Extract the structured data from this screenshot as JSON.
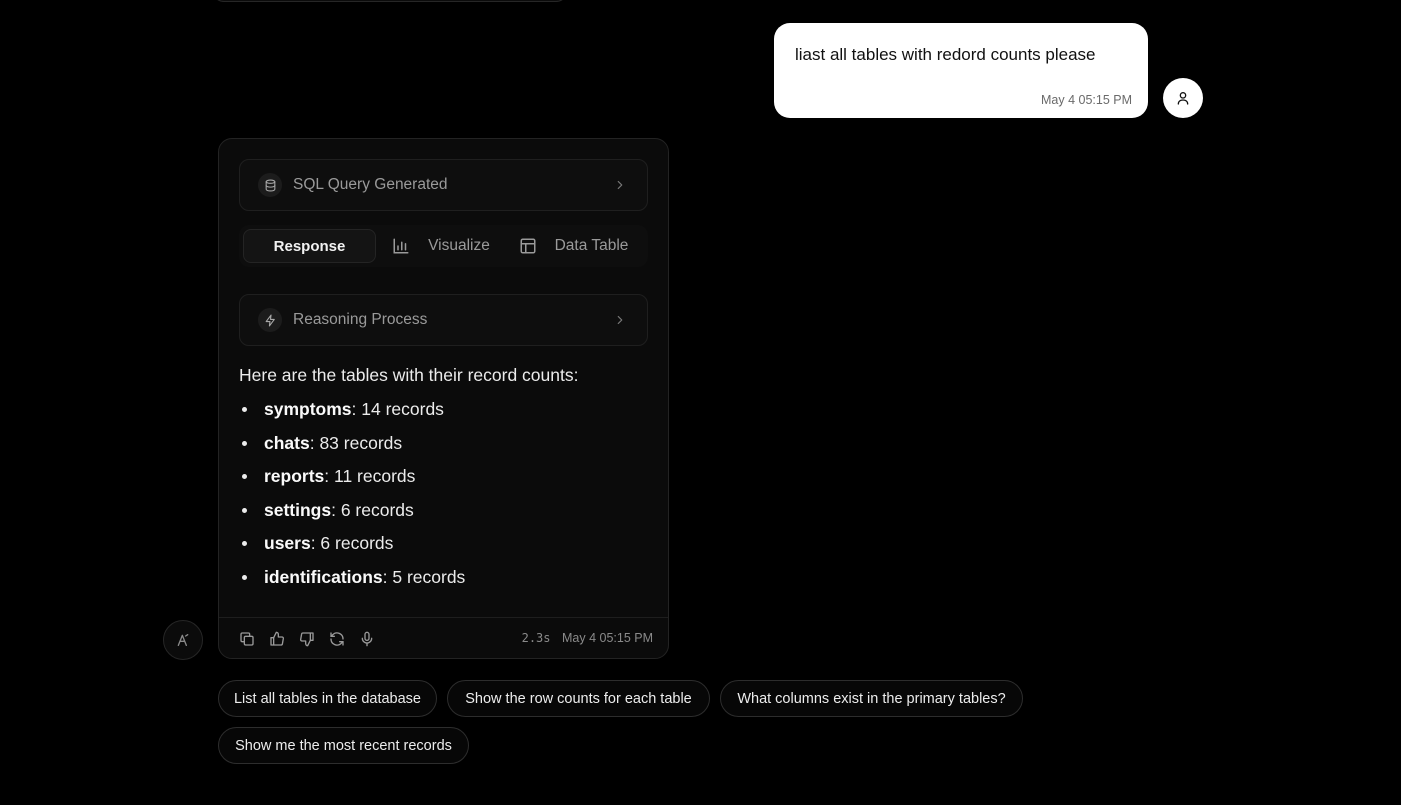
{
  "user_message": {
    "text": "liast all tables with redord counts please",
    "time": "May 4 05:15 PM"
  },
  "assistant": {
    "sql_label": "SQL Query Generated",
    "tabs": [
      {
        "label": "Response",
        "icon": "none",
        "active": true
      },
      {
        "label": "Visualize",
        "icon": "bar-chart-icon",
        "active": false
      },
      {
        "label": "Data Table",
        "icon": "table-icon",
        "active": false
      }
    ],
    "reasoning_label": "Reasoning Process",
    "intro": "Here are the tables with their record counts:",
    "items": [
      {
        "name": "symptoms",
        "rest": ": 14 records"
      },
      {
        "name": "chats",
        "rest": ": 83 records"
      },
      {
        "name": "reports",
        "rest": ": 11 records"
      },
      {
        "name": "settings",
        "rest": ": 6 records"
      },
      {
        "name": "users",
        "rest": ": 6 records"
      },
      {
        "name": "identifications",
        "rest": ": 5 records"
      }
    ],
    "footer": {
      "icons": [
        "copy-icon",
        "thumbs-up-icon",
        "thumbs-down-icon",
        "regenerate-icon",
        "microphone-icon"
      ],
      "duration": "2.3s",
      "time": "May 4 05:15 PM"
    }
  },
  "suggestions": [
    "List all tables in the database",
    "Show the row counts for each table",
    "What columns exist in the primary tables?",
    "Show me the most recent records"
  ]
}
